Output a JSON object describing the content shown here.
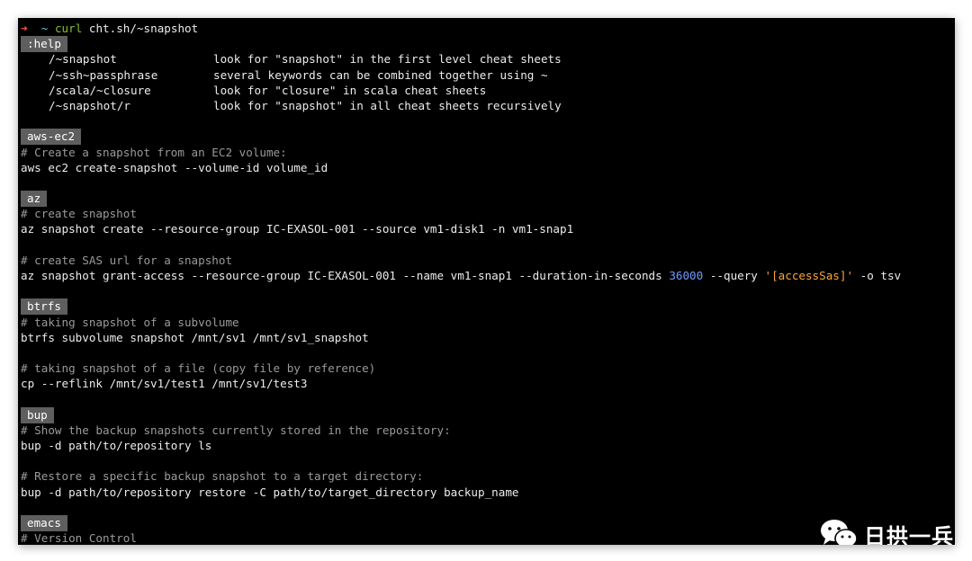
{
  "prompt": {
    "arrow": "➜",
    "dir": "~",
    "command": "curl",
    "args": "cht.sh/~snapshot"
  },
  "help": {
    "tag": ":help",
    "rows": [
      {
        "path": "/~snapshot",
        "desc": "look for \"snapshot\" in the first level cheat sheets"
      },
      {
        "path": "/~ssh~passphrase",
        "desc": "several keywords can be combined together using ~"
      },
      {
        "path": "/scala/~closure",
        "desc": "look for \"closure\" in scala cheat sheets"
      },
      {
        "path": "/~snapshot/r",
        "desc": "look for \"snapshot\" in all cheat sheets recursively"
      }
    ]
  },
  "sections": {
    "aws_ec2": {
      "tag": "aws-ec2",
      "comment1": "# Create a snapshot from an EC2 volume:",
      "cmd1": "aws ec2 create-snapshot --volume-id volume_id"
    },
    "az": {
      "tag": "az",
      "comment1": "# create snapshot",
      "cmd1": "az snapshot create --resource-group IC-EXASOL-001 --source vm1-disk1 -n vm1-snap1",
      "comment2": "# create SAS url for a snapshot",
      "cmd2_pre": "az snapshot grant-access --resource-group IC-EXASOL-001 --name vm1-snap1 --duration-in-seconds ",
      "cmd2_num": "36000",
      "cmd2_mid": " --query ",
      "cmd2_str": "'[accessSas]'",
      "cmd2_post": " -o tsv"
    },
    "btrfs": {
      "tag": "btrfs",
      "comment1": "# taking snapshot of a subvolume",
      "cmd1": "btrfs subvolume snapshot /mnt/sv1 /mnt/sv1_snapshot",
      "comment2": "# taking snapshot of a file (copy file by reference)",
      "cmd2": "cp --reflink /mnt/sv1/test1 /mnt/sv1/test3"
    },
    "bup": {
      "tag": "bup",
      "comment1": "# Show the backup snapshots currently stored in the repository:",
      "cmd1": "bup -d path/to/repository ls",
      "comment2": "# Restore a specific backup snapshot to a target directory:",
      "cmd2": "bup -d path/to/repository restore -C path/to/target_directory backup_name"
    },
    "emacs": {
      "tag": "emacs",
      "comment1": "# Version Control"
    }
  },
  "watermark": {
    "icon": "wechat-icon",
    "text": "日拱一兵"
  },
  "colors": {
    "background": "#000000",
    "text": "#ececec",
    "comment": "#9a9a9a",
    "tag_bg": "#5e5e5e",
    "number": "#6e9bff",
    "string": "#ffa53a",
    "prompt_arrow": "#ff5a4a",
    "prompt_dir": "#58d0d6",
    "prompt_cmd": "#82c42a"
  }
}
